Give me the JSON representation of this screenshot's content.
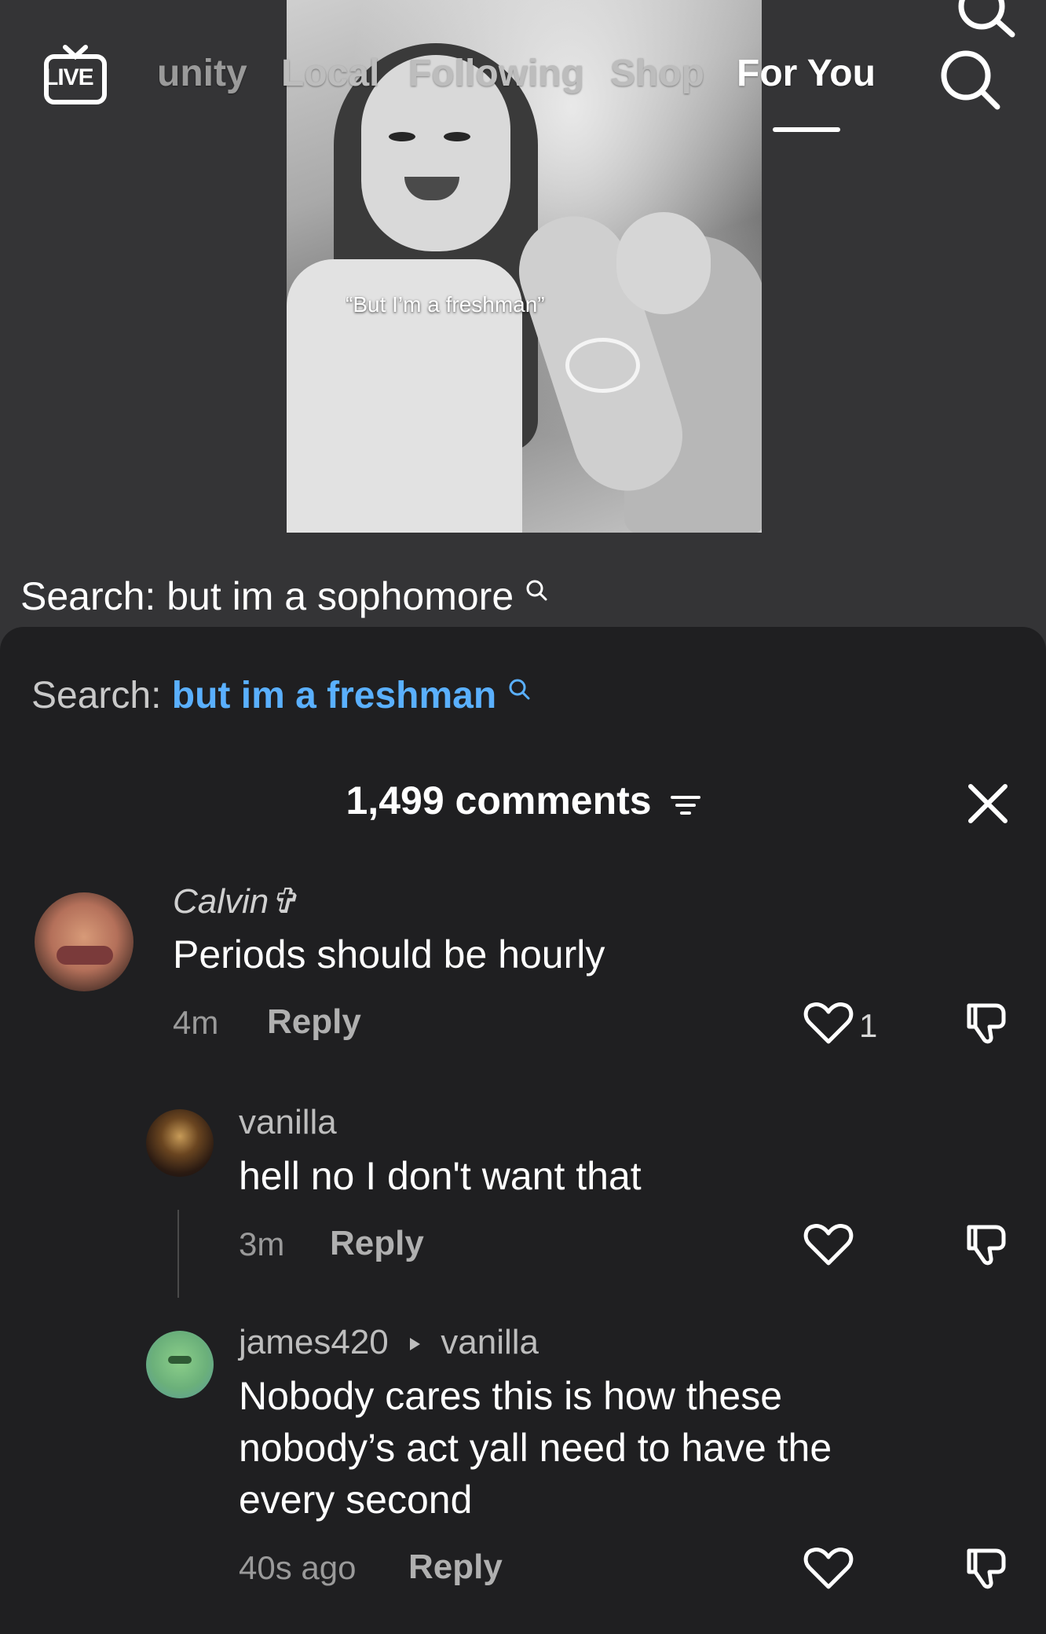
{
  "nav": {
    "live_label": "LIVE",
    "tabs": [
      "unity",
      "Local",
      "Following",
      "Shop",
      "For You"
    ],
    "active_tab": "For You"
  },
  "video": {
    "caption": "“But I’m a freshman”"
  },
  "search_suggest": {
    "label": "Search:",
    "query": "but im a sophomore"
  },
  "sheet": {
    "search_label": "Search:",
    "search_query": "but im a freshman",
    "comment_count": "1,499 comments"
  },
  "comments": [
    {
      "username": "Calvin✞",
      "text": "Periods should be hourly",
      "time": "4m",
      "reply_label": "Reply",
      "likes": "1"
    },
    {
      "username": "vanilla",
      "text": "hell no I don't want that",
      "time": "3m",
      "reply_label": "Reply",
      "likes": ""
    },
    {
      "username": "james420",
      "reply_to": "vanilla",
      "text": "Nobody cares this is how these nobody’s act yall need to have the every second",
      "time": "40s ago",
      "reply_label": "Reply",
      "likes": ""
    }
  ],
  "icons": {
    "live": "live-tv-icon",
    "search": "search-icon",
    "filter": "filter-icon",
    "close": "close-icon",
    "like": "heart-icon",
    "dislike": "thumbs-down-icon",
    "reply_arrow": "triangle-right-icon"
  },
  "colors": {
    "accent_link": "#5ab0ff",
    "sheet_bg": "#1f1f21",
    "page_bg": "#343436"
  }
}
